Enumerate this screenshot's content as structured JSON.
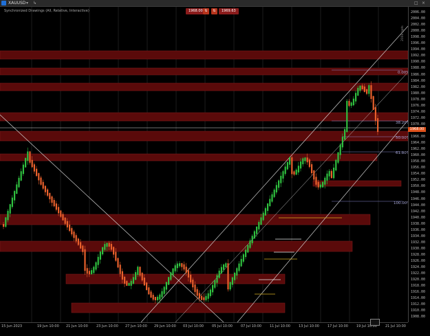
{
  "window": {
    "symbol": "XAUUSD",
    "controls": [
      "▾",
      "↳",
      "□",
      "×"
    ]
  },
  "header": {
    "sync_label": "Synchronized Drawings (All, Relative, Interactive)"
  },
  "trade": {
    "sell_price": "1968.00",
    "buy_price": "1969.63",
    "sell_btn": "⇅",
    "buy_btn": "⇅"
  },
  "y_ticks": [
    "2006.00",
    "2004.00",
    "2002.00",
    "2000.00",
    "1998.00",
    "1996.00",
    "1994.00",
    "1992.00",
    "1990.00",
    "1988.00",
    "1986.00",
    "1984.00",
    "1982.00",
    "1980.00",
    "1978.00",
    "1976.00",
    "1974.00",
    "1972.00",
    "1970.00",
    "1968.00",
    "1966.00",
    "1964.00",
    "1962.00",
    "1960.00",
    "1958.00",
    "1956.00",
    "1954.00",
    "1952.00",
    "1950.00",
    "1948.00",
    "1946.00",
    "1944.00",
    "1942.00",
    "1940.00",
    "1938.00",
    "1936.00",
    "1934.00",
    "1932.00",
    "1930.00",
    "1928.00",
    "1926.00",
    "1924.00",
    "1922.00",
    "1920.00",
    "1918.00",
    "1916.00",
    "1914.00",
    "1912.00",
    "1910.00",
    "1908.00"
  ],
  "x_ticks": [
    "15 Jun 2023",
    "19 Jun 10:00",
    "21 Jun 10:00",
    "23 Jun 10:00",
    "27 Jun 10:00",
    "29 Jun 10:00",
    "03 Jul 10:00",
    "05 Jul 10:00",
    "07 Jul 10:00",
    "11 Jul 10:00",
    "13 Jul 10:00",
    "17 Jul 10:00",
    "19 Jul 10:00",
    "21 Jul 10:00"
  ],
  "fib_levels": [
    "0.00%",
    "38.20%",
    "50.00%",
    "61.80%",
    "100.00%"
  ],
  "current_price": "1968.00",
  "vertical_note": "2000 ppts",
  "colors": {
    "zone": "#5a0a0a",
    "bull": "#2fbf3f",
    "bear": "#e8602c",
    "fib": "#8888cc",
    "trend": "#cfcfcf"
  }
}
